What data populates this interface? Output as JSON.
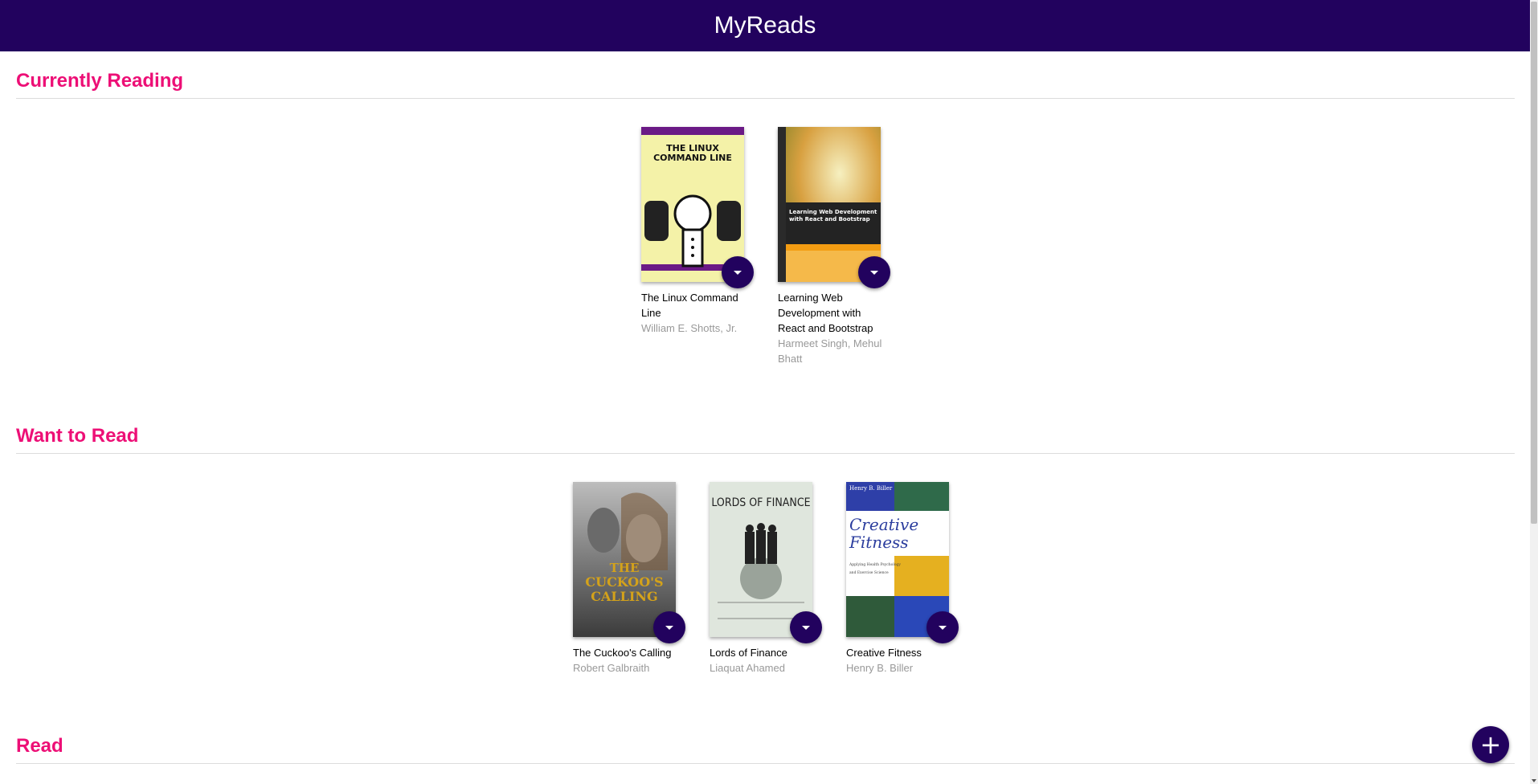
{
  "header": {
    "title": "MyReads"
  },
  "shelves": [
    {
      "title": "Currently Reading",
      "books": [
        {
          "title": "The Linux Command Line",
          "authors": "William E. Shotts, Jr."
        },
        {
          "title": "Learning Web Development with React and Bootstrap",
          "authors": "Harmeet Singh, Mehul Bhatt"
        }
      ]
    },
    {
      "title": "Want to Read",
      "books": [
        {
          "title": "The Cuckoo's Calling",
          "authors": "Robert Galbraith"
        },
        {
          "title": "Lords of Finance",
          "authors": "Liaquat Ahamed"
        },
        {
          "title": "Creative Fitness",
          "authors": "Henry B. Biller"
        }
      ]
    },
    {
      "title": "Read",
      "books": []
    }
  ],
  "fab": {
    "label": "+"
  },
  "covers": {
    "linux": {
      "title": "THE LINUX COMMAND LINE"
    },
    "react": {
      "title": "Learning Web Development with React and Bootstrap"
    },
    "cuckoo": {
      "title": "THE CUCKOO'S CALLING"
    },
    "lords": {
      "title": "LORDS OF FINANCE"
    },
    "fitness": {
      "title": "Creative Fitness",
      "author": "Henry B. Biller"
    }
  },
  "colors": {
    "header": "#22025e",
    "accent": "#ed0f76"
  }
}
